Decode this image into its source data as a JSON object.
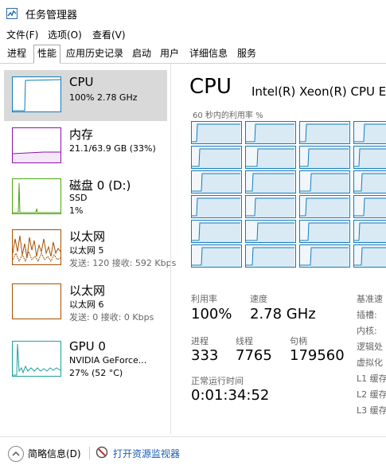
{
  "window": {
    "title": "任务管理器",
    "icon": "task-manager-icon"
  },
  "menu": [
    {
      "label": "文件(F)"
    },
    {
      "label": "选项(O)"
    },
    {
      "label": "查看(V)"
    }
  ],
  "tabs": [
    {
      "label": "进程"
    },
    {
      "label": "性能",
      "active": true
    },
    {
      "label": "应用历史记录"
    },
    {
      "label": "启动"
    },
    {
      "label": "用户"
    },
    {
      "label": "详细信息"
    },
    {
      "label": "服务"
    }
  ],
  "resources": [
    {
      "title": "CPU",
      "lines": [
        "100% 2.78 GHz"
      ],
      "color": "#117dbb",
      "selected": true
    },
    {
      "title": "内存",
      "lines": [
        "21.1/63.9 GB (33%)"
      ],
      "color": "#8b12ae"
    },
    {
      "title": "磁盘 0 (D:)",
      "lines": [
        "SSD",
        "1%"
      ],
      "color": "#4da60c"
    },
    {
      "title": "以太网",
      "lines": [
        "以太网 5",
        "发送: 120  接收: 592 Kbps"
      ],
      "color": "#a74f01"
    },
    {
      "title": "以太网",
      "lines": [
        "以太网 6",
        "发送: 0  接收: 0 Kbps"
      ],
      "color": "#a74f01"
    },
    {
      "title": "GPU 0",
      "lines": [
        "NVIDIA GeForce...",
        "27% (52 °C)"
      ],
      "color": "#1aa0a0"
    }
  ],
  "main": {
    "heading": "CPU",
    "model": "Intel(R) Xeon(R) CPU E",
    "util_label": "60 秒内的利用率 %",
    "stats": {
      "util_label": "利用率",
      "util_value": "100%",
      "speed_label": "速度",
      "speed_value": "2.78 GHz",
      "proc_label": "进程",
      "proc_value": "333",
      "thread_label": "线程",
      "thread_value": "7765",
      "handle_label": "句柄",
      "handle_value": "179560",
      "uptime_label": "正常运行时间",
      "uptime_value": "0:01:34:52"
    },
    "side": [
      "基准速",
      "插槽:",
      "内核:",
      "逻辑处",
      "虚拟化",
      "L1 缓存",
      "L2 缓存",
      "L3 缓存"
    ]
  },
  "footer": {
    "brief": "简略信息(D)",
    "monitor": "打开资源监视器"
  },
  "colors": {
    "cpu": "#117dbb",
    "mem": "#8b12ae",
    "disk": "#4da60c",
    "net": "#a74f01",
    "gpu": "#1aa0a0"
  }
}
